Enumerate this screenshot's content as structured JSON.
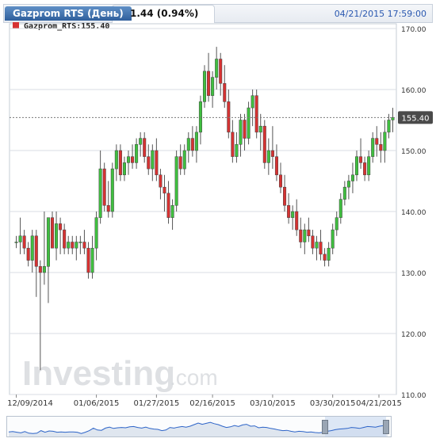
{
  "header": {
    "tab_title": "Gazprom  RTS (День)",
    "change": "1.44 (0.94%)",
    "timestamp": "04/21/2015 17:59:00"
  },
  "legend": {
    "label": "Gazprom_RTS:155.40"
  },
  "watermark": {
    "brand_main": "Investing",
    "brand_suffix": ".com"
  },
  "colors": {
    "up": "#3fbf3f",
    "down": "#d63232",
    "price_box": "#4a4a4a",
    "accent": "#2a58b0"
  },
  "chart_data": {
    "type": "candlestick",
    "last_price_label": "155.40",
    "last_price": 155.4,
    "ylim": [
      110,
      170
    ],
    "yticks": [
      110,
      120,
      130,
      140,
      150,
      160,
      170
    ],
    "ytick_labels": [
      "110.00",
      "120.00",
      "130.00",
      "140.00",
      "150.00",
      "160.00",
      "170.00"
    ],
    "xtick_labels": [
      "12/09/2014",
      "01/06/2015",
      "01/27/2015",
      "02/16/2015",
      "03/10/2015",
      "03/30/2015",
      "04/21/2015"
    ],
    "xtick_index": [
      0,
      20,
      35,
      49,
      64,
      79,
      95
    ],
    "candles": [
      [
        135,
        136,
        134,
        135
      ],
      [
        135,
        139,
        133,
        136
      ],
      [
        136,
        137,
        133,
        134
      ],
      [
        134,
        135,
        131,
        132
      ],
      [
        132,
        137,
        130,
        136
      ],
      [
        136,
        137,
        126,
        131
      ],
      [
        131,
        132,
        114,
        130
      ],
      [
        130,
        140,
        128,
        131
      ],
      [
        131,
        134,
        125,
        139
      ],
      [
        139,
        140,
        134,
        134
      ],
      [
        134,
        140,
        132,
        138
      ],
      [
        138,
        139,
        133,
        137
      ],
      [
        137,
        138,
        133,
        134
      ],
      [
        134,
        136,
        133,
        135
      ],
      [
        135,
        136,
        133,
        134
      ],
      [
        134,
        136,
        132,
        135
      ],
      [
        135,
        136,
        133,
        135
      ],
      [
        135,
        137,
        133,
        134
      ],
      [
        134,
        135,
        129,
        130
      ],
      [
        130,
        136,
        129,
        134
      ],
      [
        134,
        140,
        132,
        139
      ],
      [
        139,
        150,
        138,
        147
      ],
      [
        147,
        148,
        140,
        141
      ],
      [
        141,
        145,
        139,
        140
      ],
      [
        140,
        148,
        139,
        147
      ],
      [
        147,
        151,
        145,
        150
      ],
      [
        150,
        151,
        145,
        146
      ],
      [
        146,
        149,
        145,
        148
      ],
      [
        148,
        150,
        146,
        149
      ],
      [
        149,
        151,
        147,
        148
      ],
      [
        148,
        152,
        147,
        151
      ],
      [
        151,
        153,
        149,
        152
      ],
      [
        152,
        153,
        148,
        149
      ],
      [
        149,
        151,
        146,
        147
      ],
      [
        147,
        151,
        145,
        150
      ],
      [
        150,
        152,
        145,
        146
      ],
      [
        146,
        147,
        142,
        144
      ],
      [
        144,
        146,
        140,
        143
      ],
      [
        143,
        145,
        138,
        139
      ],
      [
        139,
        142,
        137,
        141
      ],
      [
        141,
        150,
        140,
        149
      ],
      [
        149,
        151,
        146,
        147
      ],
      [
        147,
        151,
        146,
        150
      ],
      [
        150,
        153,
        148,
        152
      ],
      [
        152,
        154,
        149,
        150
      ],
      [
        150,
        154,
        148,
        153
      ],
      [
        153,
        159,
        151,
        158
      ],
      [
        158,
        164,
        157,
        163
      ],
      [
        163,
        166,
        158,
        159
      ],
      [
        159,
        163,
        157,
        162
      ],
      [
        162,
        167,
        160,
        165
      ],
      [
        165,
        166,
        159,
        161
      ],
      [
        161,
        164,
        157,
        158
      ],
      [
        158,
        160,
        152,
        153
      ],
      [
        153,
        155,
        148,
        149
      ],
      [
        149,
        153,
        148,
        151
      ],
      [
        151,
        156,
        149,
        155
      ],
      [
        155,
        156,
        150,
        152
      ],
      [
        152,
        158,
        151,
        157
      ],
      [
        157,
        160,
        154,
        159
      ],
      [
        159,
        160,
        152,
        153
      ],
      [
        153,
        156,
        150,
        154
      ],
      [
        154,
        155,
        147,
        148
      ],
      [
        148,
        152,
        146,
        150
      ],
      [
        150,
        154,
        147,
        149
      ],
      [
        149,
        151,
        145,
        146
      ],
      [
        146,
        148,
        143,
        144
      ],
      [
        144,
        146,
        140,
        141
      ],
      [
        141,
        143,
        138,
        139
      ],
      [
        139,
        141,
        137,
        140
      ],
      [
        140,
        142,
        136,
        137
      ],
      [
        137,
        139,
        134,
        135
      ],
      [
        135,
        138,
        133,
        137
      ],
      [
        137,
        139,
        135,
        136
      ],
      [
        136,
        137,
        133,
        134
      ],
      [
        134,
        136,
        132,
        135
      ],
      [
        135,
        137,
        132,
        133
      ],
      [
        133,
        134,
        131,
        132
      ],
      [
        132,
        135,
        131,
        134
      ],
      [
        134,
        138,
        133,
        137
      ],
      [
        137,
        140,
        136,
        139
      ],
      [
        139,
        143,
        138,
        142
      ],
      [
        142,
        145,
        141,
        144
      ],
      [
        144,
        146,
        142,
        145
      ],
      [
        145,
        148,
        143,
        146
      ],
      [
        146,
        150,
        145,
        149
      ],
      [
        149,
        152,
        147,
        148
      ],
      [
        148,
        149,
        145,
        146
      ],
      [
        146,
        150,
        145,
        149
      ],
      [
        149,
        153,
        148,
        152
      ],
      [
        152,
        154,
        149,
        151
      ],
      [
        151,
        153,
        148,
        150
      ],
      [
        150,
        155,
        148,
        153
      ],
      [
        153,
        156,
        152,
        155
      ],
      [
        155,
        157,
        153,
        155.4
      ]
    ]
  }
}
